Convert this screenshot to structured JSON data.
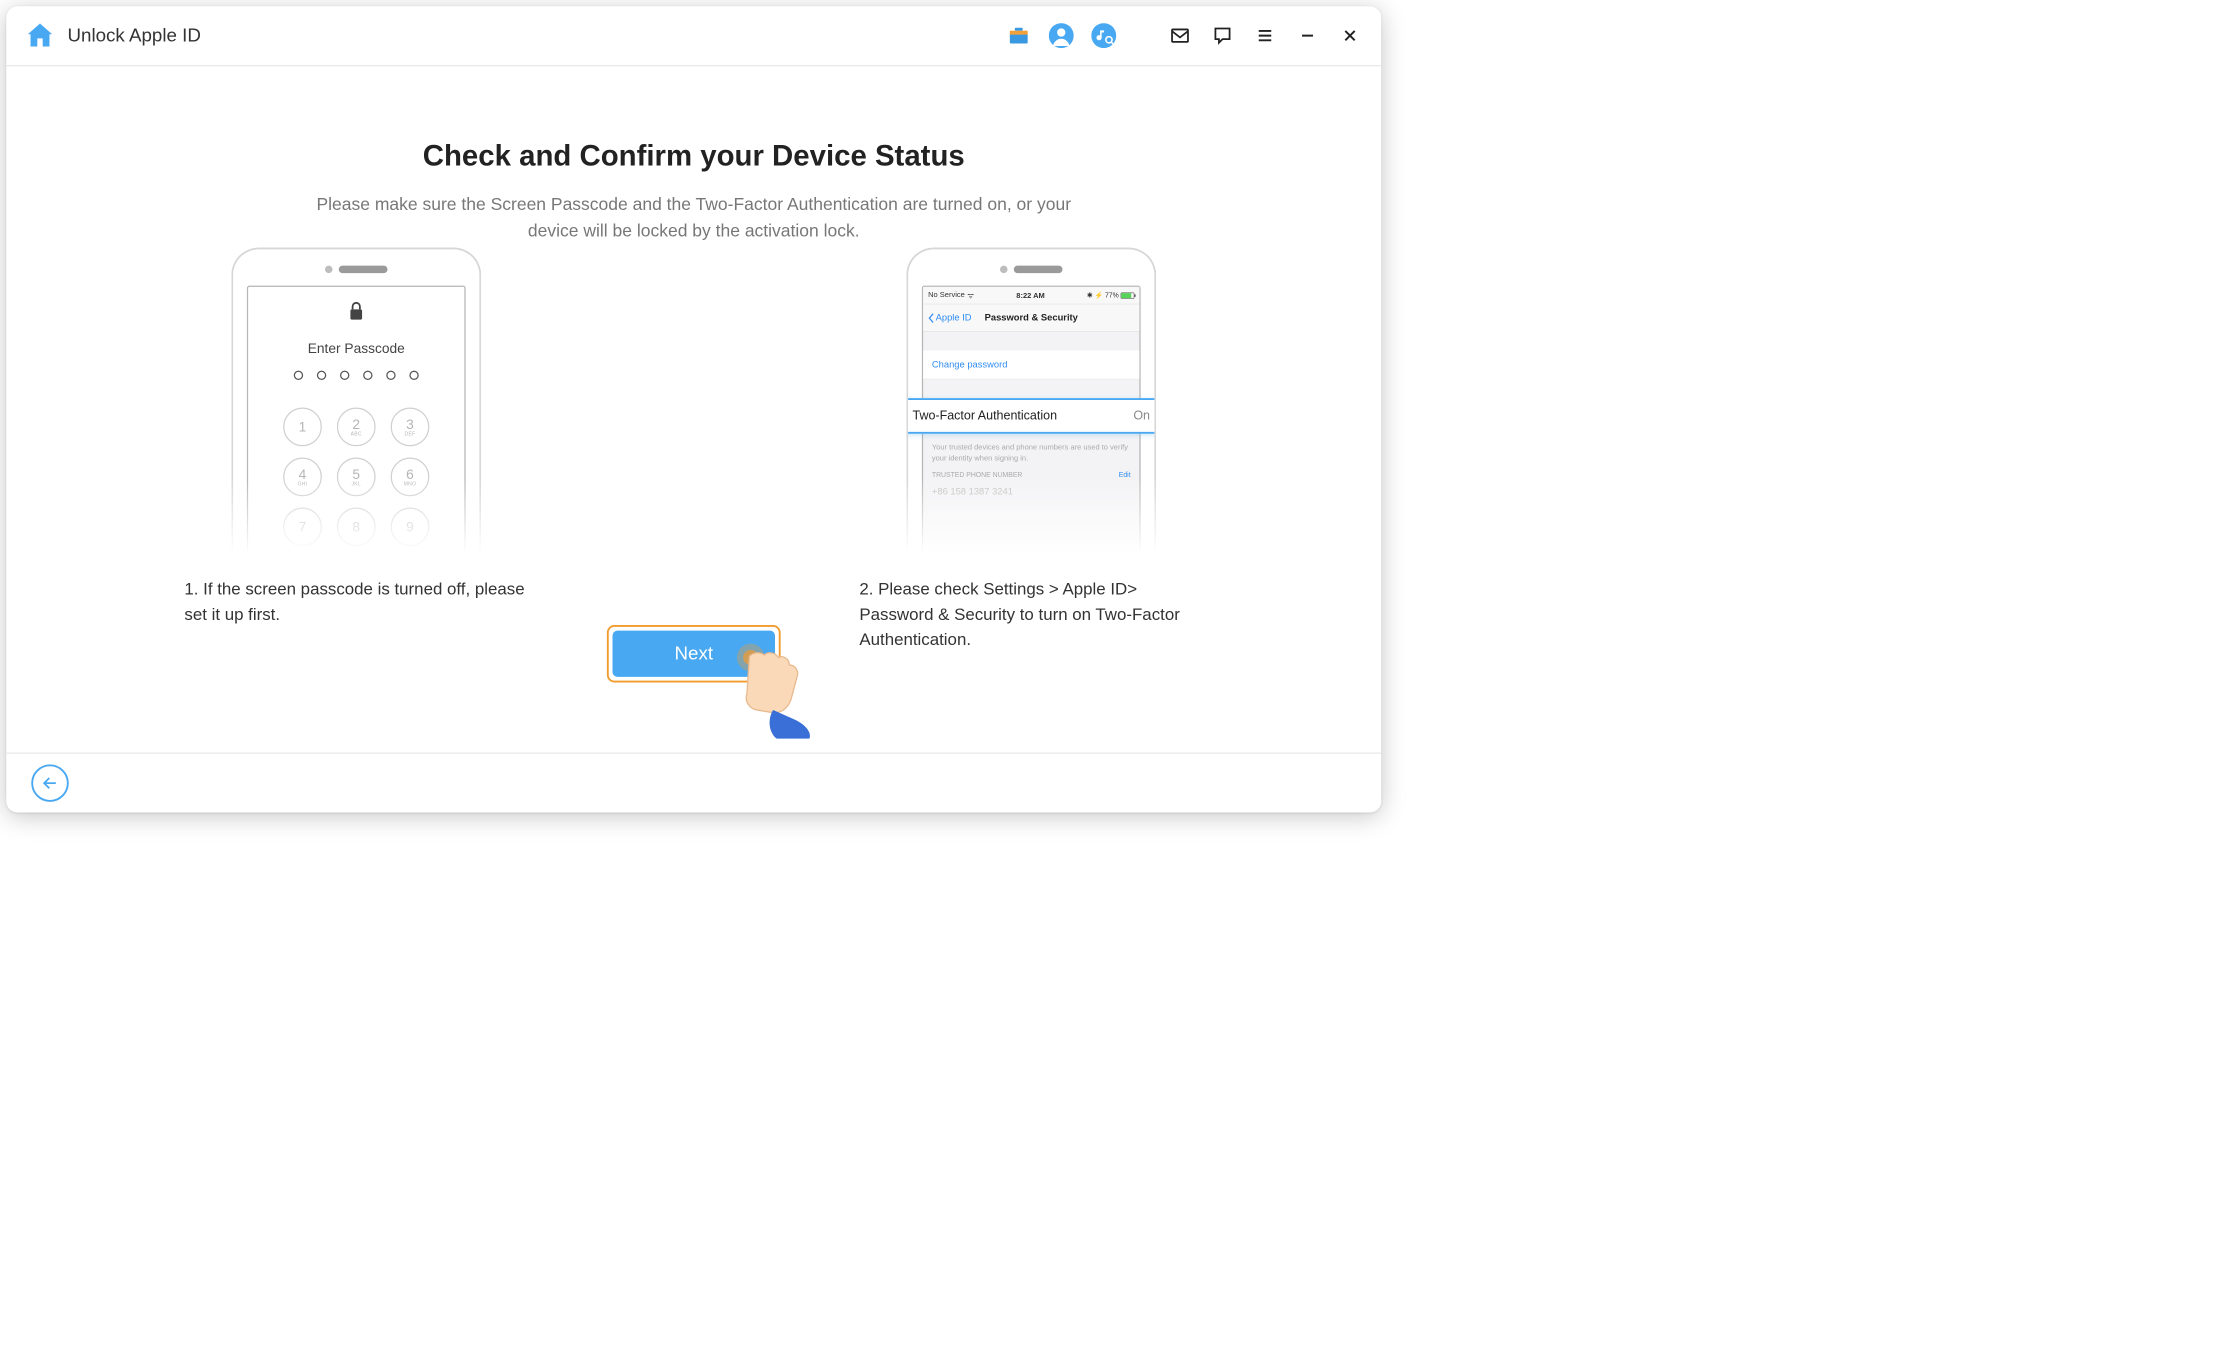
{
  "header": {
    "title": "Unlock Apple ID"
  },
  "main": {
    "headline": "Check and Confirm your Device Status",
    "subtext": "Please make sure the Screen Passcode and the Two-Factor Authentication are turned on, or your device will be locked by the activation lock."
  },
  "phone1": {
    "enter_passcode_label": "Enter Passcode",
    "keys": [
      {
        "n": "1",
        "l": ""
      },
      {
        "n": "2",
        "l": "ABC"
      },
      {
        "n": "3",
        "l": "DEF"
      },
      {
        "n": "4",
        "l": "GHI"
      },
      {
        "n": "5",
        "l": "JKL"
      },
      {
        "n": "6",
        "l": "MNO"
      },
      {
        "n": "7",
        "l": ""
      },
      {
        "n": "8",
        "l": ""
      },
      {
        "n": "9",
        "l": ""
      }
    ]
  },
  "phone2": {
    "statusbar": {
      "carrier": "No Service",
      "time": "8:22 AM",
      "battery": "77%"
    },
    "nav_back": "Apple ID",
    "nav_title": "Password & Security",
    "change_password_label": "Change password",
    "tfa_label": "Two-Factor Authentication",
    "tfa_value": "On",
    "footnote": "Your trusted devices and phone numbers are used to verify your identity when signing in.",
    "trusted_header": "TRUSTED PHONE NUMBER",
    "edit_label": "Edit",
    "phone_number": "+86 158 1387 3241"
  },
  "captions": {
    "left": "1. If the screen passcode is turned off, please set it up first.",
    "right": "2. Please check Settings > Apple ID> Password & Security to turn on Two-Factor Authentication."
  },
  "next_label": "Next",
  "colors": {
    "accent": "#49a8f2",
    "highlight_border": "#f29b2e"
  }
}
